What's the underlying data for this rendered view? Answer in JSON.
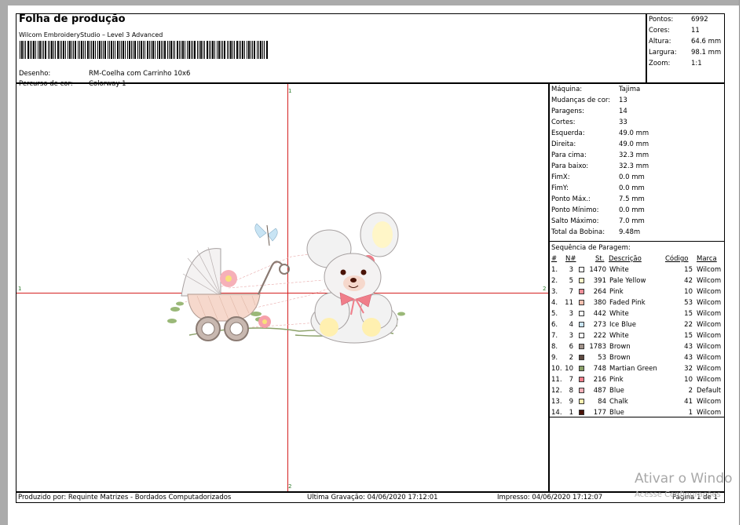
{
  "header": {
    "title": "Folha de produção",
    "subtitle": "Wilcom EmbroideryStudio – Level 3 Advanced",
    "design_label": "Desenho:",
    "design_value": "RM-Coelha com Carrinho 10x6",
    "colorway_label": "Percurso de cor:",
    "colorway_value": "Colorway 1"
  },
  "stats": [
    {
      "label": "Pontos:",
      "value": "6992"
    },
    {
      "label": "Cores:",
      "value": "11"
    },
    {
      "label": "Altura:",
      "value": "64.6 mm"
    },
    {
      "label": "Largura:",
      "value": "98.1 mm"
    },
    {
      "label": "Zoom:",
      "value": "1:1"
    }
  ],
  "machine_info": [
    {
      "label": "Máquina:",
      "value": "Tajima"
    },
    {
      "label": "Mudanças de cor:",
      "value": "13"
    },
    {
      "label": "Paragens:",
      "value": "14"
    },
    {
      "label": "Cortes:",
      "value": "33"
    },
    {
      "label": "Esquerda:",
      "value": "49.0 mm"
    },
    {
      "label": "Direita:",
      "value": "49.0 mm"
    },
    {
      "label": "Para cima:",
      "value": "32.3 mm"
    },
    {
      "label": "Para baixo:",
      "value": "32.3 mm"
    },
    {
      "label": "FimX:",
      "value": "0.0 mm"
    },
    {
      "label": "FimY:",
      "value": "0.0 mm"
    },
    {
      "label": "Ponto Máx.:",
      "value": "7.5 mm"
    },
    {
      "label": "Ponto Mínimo:",
      "value": "0.0 mm"
    },
    {
      "label": "Salto Máximo:",
      "value": "7.0 mm"
    },
    {
      "label": "Total da Bobina:",
      "value": "9.48m"
    }
  ],
  "sequence": {
    "title": "Sequência de Paragem:",
    "headers": {
      "num": "#",
      "n": "N#",
      "st": "St.",
      "desc": "Descrição",
      "code": "Código",
      "brand": "Marca"
    },
    "rows": [
      {
        "num": "1.",
        "n": "3",
        "color": "#ffffff",
        "st": "1470",
        "desc": "White",
        "code": "15",
        "brand": "Wilcom"
      },
      {
        "num": "2.",
        "n": "5",
        "color": "#fff6c8",
        "st": "391",
        "desc": "Pale Yellow",
        "code": "42",
        "brand": "Wilcom"
      },
      {
        "num": "3.",
        "n": "7",
        "color": "#f0909a",
        "st": "264",
        "desc": "Pink",
        "code": "10",
        "brand": "Wilcom"
      },
      {
        "num": "4.",
        "n": "11",
        "color": "#f6c0b0",
        "st": "380",
        "desc": "Faded Pink",
        "code": "53",
        "brand": "Wilcom"
      },
      {
        "num": "5.",
        "n": "3",
        "color": "#ffffff",
        "st": "442",
        "desc": "White",
        "code": "15",
        "brand": "Wilcom"
      },
      {
        "num": "6.",
        "n": "4",
        "color": "#c8e4f4",
        "st": "273",
        "desc": "Ice Blue",
        "code": "22",
        "brand": "Wilcom"
      },
      {
        "num": "7.",
        "n": "3",
        "color": "#ffffff",
        "st": "222",
        "desc": "White",
        "code": "15",
        "brand": "Wilcom"
      },
      {
        "num": "8.",
        "n": "6",
        "color": "#a0928a",
        "st": "1783",
        "desc": "Brown",
        "code": "43",
        "brand": "Wilcom"
      },
      {
        "num": "9.",
        "n": "2",
        "color": "#5e4a40",
        "st": "53",
        "desc": "Brown",
        "code": "43",
        "brand": "Wilcom"
      },
      {
        "num": "10.",
        "n": "10",
        "color": "#8aa068",
        "st": "748",
        "desc": "Martian Green",
        "code": "32",
        "brand": "Wilcom"
      },
      {
        "num": "11.",
        "n": "7",
        "color": "#f07e8a",
        "st": "216",
        "desc": "Pink",
        "code": "10",
        "brand": "Wilcom"
      },
      {
        "num": "12.",
        "n": "8",
        "color": "#f4b0b8",
        "st": "487",
        "desc": "Blue",
        "code": "2",
        "brand": "Default"
      },
      {
        "num": "13.",
        "n": "9",
        "color": "#fff0b0",
        "st": "84",
        "desc": "Chalk",
        "code": "41",
        "brand": "Wilcom"
      },
      {
        "num": "14.",
        "n": "1",
        "color": "#4a1408",
        "st": "177",
        "desc": "Blue",
        "code": "1",
        "brand": "Wilcom"
      }
    ]
  },
  "footer": {
    "produced_by": "Produzido por: Requinte Matrizes - Bordados Computadorizados",
    "last_save": "Ultima Gravação: 04/06/2020 17:12:01",
    "printed": "Impresso: 04/06/2020 17:12:07",
    "page": "Página 1 de 1"
  },
  "crosshair_labels": {
    "top": "1",
    "bottom": "2",
    "left": "1",
    "right": "2"
  },
  "watermark": {
    "line1": "Ativar o Windo",
    "line2": "Acesse Configurações"
  },
  "colors": {
    "crosshair": "#d42020"
  }
}
